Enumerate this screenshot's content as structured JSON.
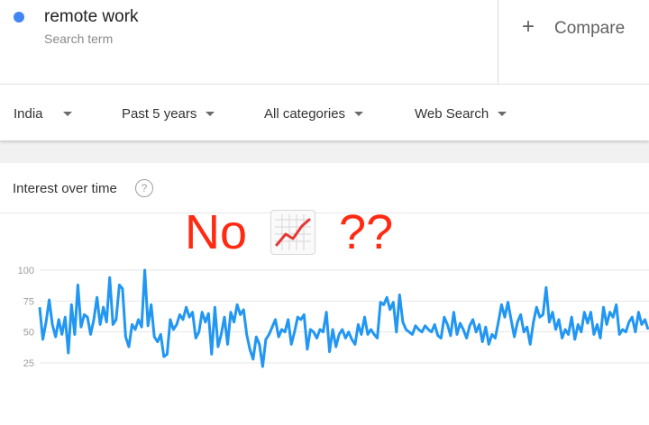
{
  "search_term": {
    "label": "remote work",
    "sublabel": "Search term",
    "color": "#4285f4"
  },
  "compare": {
    "icon": "plus-icon",
    "plus": "+",
    "label": "Compare"
  },
  "filters": [
    {
      "label": "India",
      "icon": "caret-down-icon"
    },
    {
      "label": "Past 5 years",
      "icon": "caret-down-icon"
    },
    {
      "label": "All categories",
      "icon": "caret-down-icon"
    },
    {
      "label": "Web Search",
      "icon": "caret-down-icon"
    }
  ],
  "card": {
    "title": "Interest over time",
    "help_icon": "question-mark-icon",
    "help_glyph": "?"
  },
  "annotation": {
    "prefix": "No",
    "emoji": "chart-increasing-emoji",
    "suffix": "??",
    "color": "#ff2a12"
  },
  "chart_data": {
    "type": "line",
    "yticks": [
      100,
      75,
      50,
      25
    ],
    "ylim": [
      0,
      100
    ],
    "grid": true,
    "series": [
      {
        "color": "#2196f3",
        "values": [
          70,
          44,
          58,
          76,
          56,
          46,
          60,
          48,
          62,
          33,
          72,
          48,
          88,
          54,
          64,
          62,
          48,
          60,
          78,
          56,
          70,
          58,
          94,
          56,
          60,
          88,
          85,
          46,
          38,
          56,
          52,
          60,
          54,
          100,
          55,
          72,
          46,
          42,
          48,
          30,
          32,
          60,
          52,
          56,
          64,
          60,
          70,
          62,
          66,
          45,
          50,
          66,
          58,
          65,
          32,
          70,
          38,
          48,
          62,
          40,
          66,
          58,
          72,
          64,
          68,
          48,
          36,
          28,
          46,
          40,
          22,
          44,
          48,
          54,
          60,
          46,
          52,
          50,
          60,
          40,
          50,
          62,
          60,
          64,
          36,
          52,
          50,
          45,
          52,
          50,
          66,
          34,
          52,
          38,
          48,
          52,
          45,
          50,
          44,
          40,
          56,
          48,
          62,
          48,
          52,
          48,
          45,
          74,
          72,
          78,
          68,
          74,
          50,
          80,
          58,
          52,
          50,
          48,
          55,
          52,
          50,
          55,
          52,
          50,
          56,
          47,
          45,
          62,
          56,
          47,
          66,
          48,
          57,
          52,
          45,
          55,
          60,
          50,
          56,
          42,
          54,
          40,
          48,
          45,
          58,
          72,
          62,
          74,
          60,
          46,
          58,
          64,
          50,
          54,
          40,
          58,
          70,
          62,
          64,
          86,
          58,
          66,
          52,
          60,
          45,
          52,
          48,
          62,
          44,
          56,
          50,
          66,
          57,
          66,
          48,
          56,
          45,
          70,
          56,
          66,
          62,
          72,
          48,
          52,
          50,
          58,
          62,
          50,
          66,
          56,
          60,
          52
        ]
      }
    ]
  }
}
